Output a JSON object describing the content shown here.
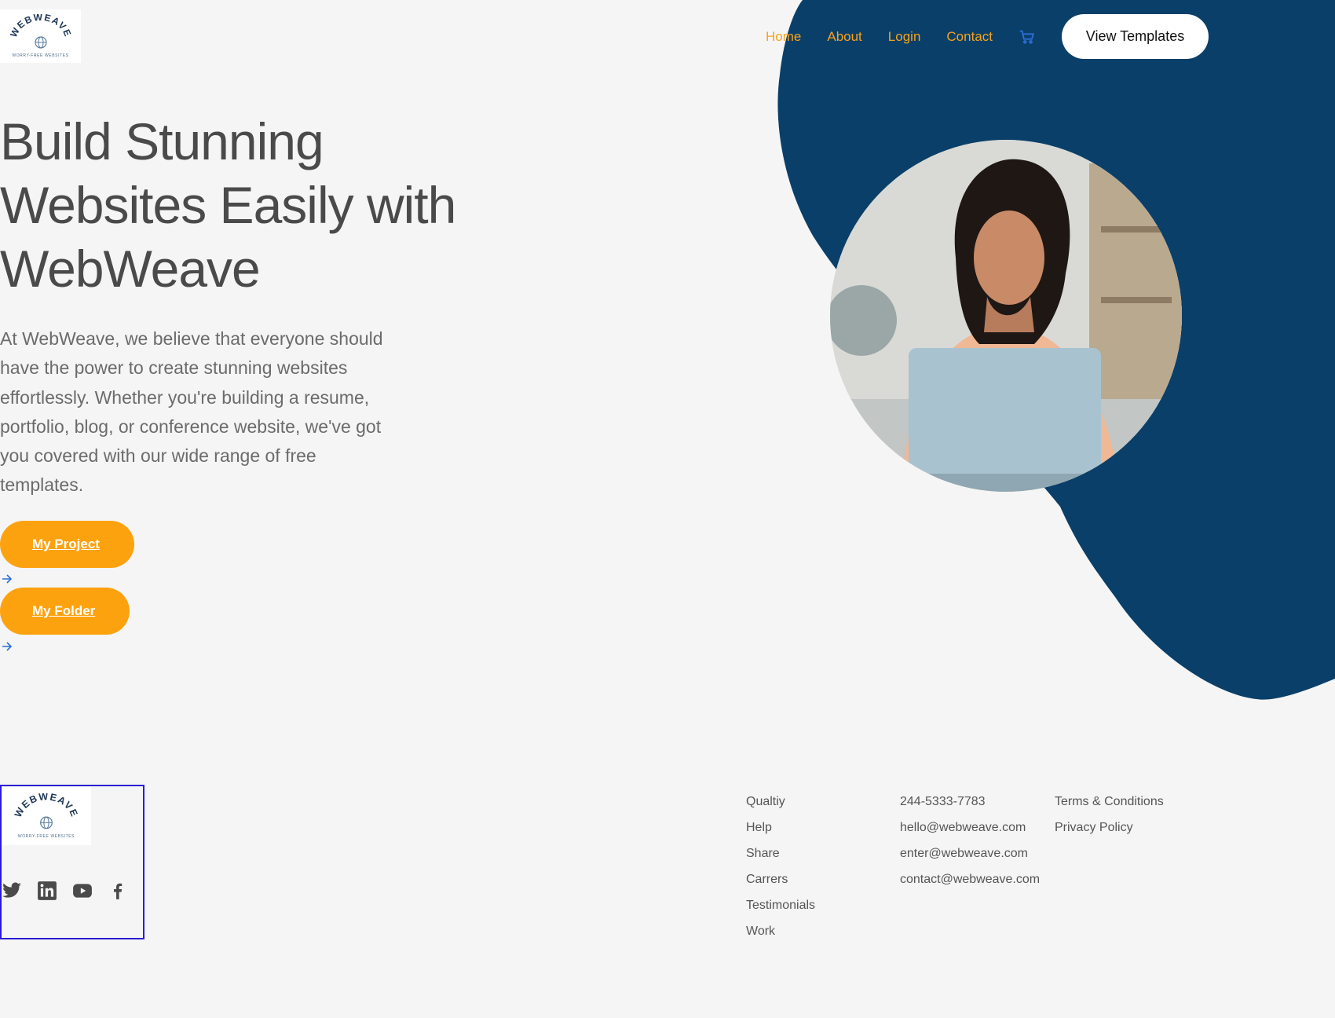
{
  "brand": {
    "logo_text": "WEBWEAVE",
    "logo_tagline": "WORRY-FREE WEBSITES"
  },
  "nav": {
    "items": [
      {
        "label": "Home",
        "active": true
      },
      {
        "label": "About"
      },
      {
        "label": "Login"
      },
      {
        "label": "Contact"
      }
    ],
    "cart_icon": "cart-icon",
    "cta_label": "View Templates"
  },
  "hero": {
    "title": "Build Stunning Websites Easily with WebWeave",
    "description": "At WebWeave, we believe that everyone should have the power to create stunning websites effortlessly. Whether you're building a resume, portfolio, blog, or conference website, we've got you covered with our wide range of free templates.",
    "buttons": [
      {
        "label": "My Project",
        "icon": "arrow-right-icon"
      },
      {
        "label": "My Folder",
        "icon": "arrow-right-icon"
      }
    ]
  },
  "footer": {
    "socials": [
      "twitter-icon",
      "linkedin-icon",
      "youtube-icon",
      "facebook-icon"
    ],
    "links": [
      "Qualtiy",
      "Help",
      "Share",
      "Carrers",
      "Testimonials",
      "Work"
    ],
    "contacts": [
      "244-5333-7783",
      "hello@webweave.com",
      "enter@webweave.com",
      "contact@webweave.com"
    ],
    "legal": [
      "Terms & Conditions",
      "Privacy Policy"
    ]
  },
  "colors": {
    "navy": "#0a3f69",
    "orange": "#fda20f",
    "background": "#f5f5f5",
    "text": "#4a4a4a"
  }
}
